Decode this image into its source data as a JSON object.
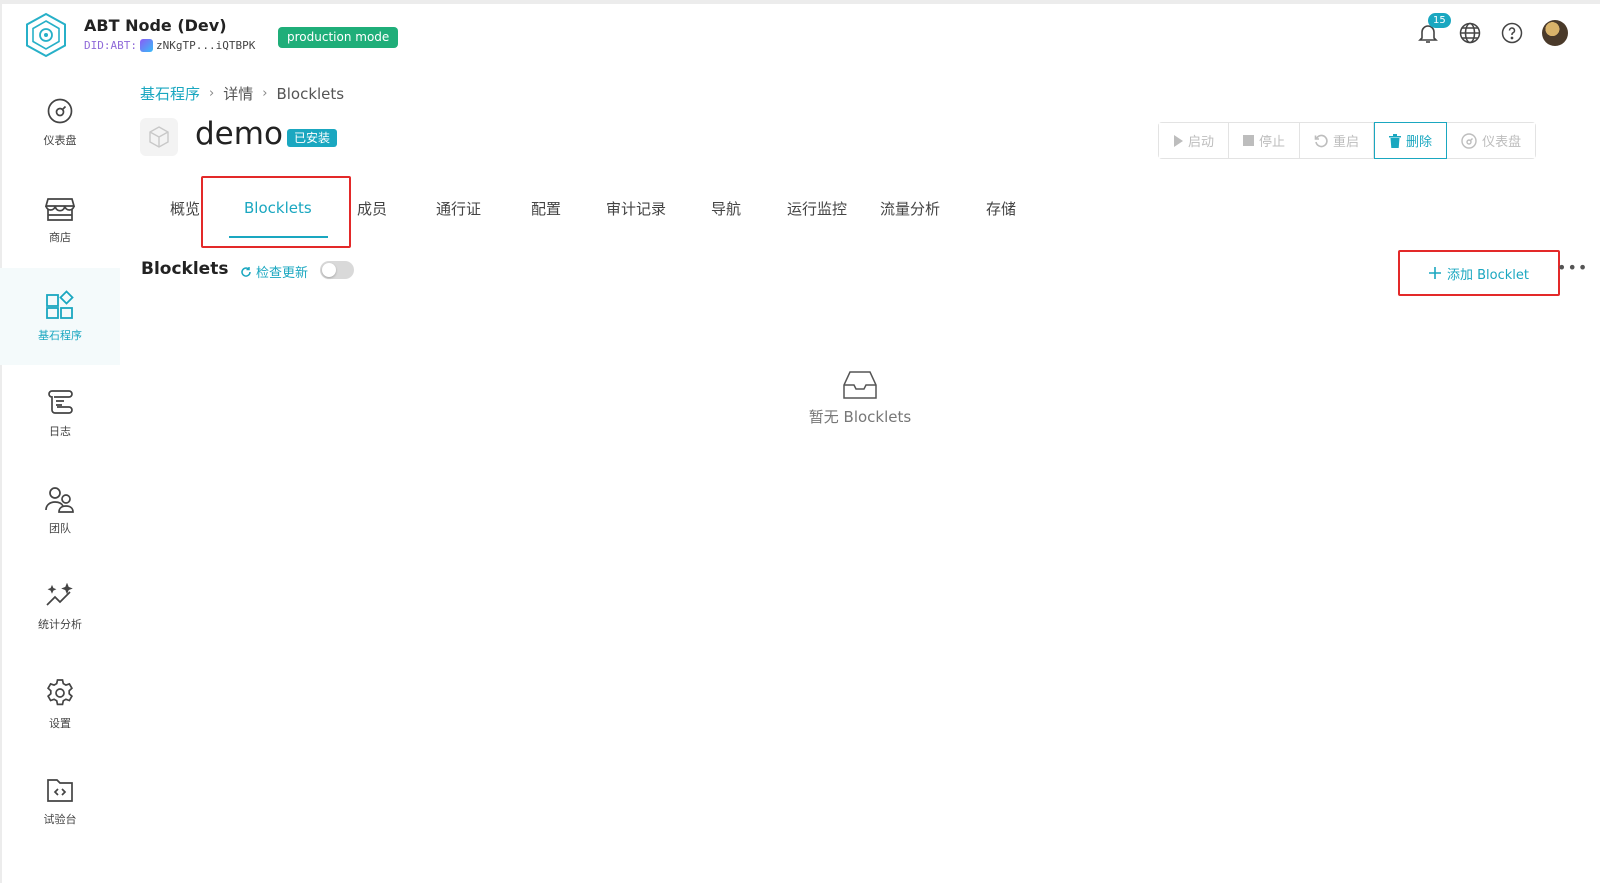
{
  "header": {
    "app_title": "ABT Node (Dev)",
    "did_label": "DID:ABT:",
    "did_value": "zNKgTP...iQTBPK",
    "mode_badge": "production mode",
    "notification_count": "15"
  },
  "sidebar": {
    "items": [
      {
        "label": "仪表盘",
        "icon": "dashboard-icon"
      },
      {
        "label": "商店",
        "icon": "store-icon"
      },
      {
        "label": "基石程序",
        "icon": "blocklet-icon",
        "active": true
      },
      {
        "label": "日志",
        "icon": "logs-icon"
      },
      {
        "label": "团队",
        "icon": "team-icon"
      },
      {
        "label": "统计分析",
        "icon": "analytics-icon"
      },
      {
        "label": "设置",
        "icon": "settings-icon"
      },
      {
        "label": "试验台",
        "icon": "playground-icon"
      }
    ]
  },
  "breadcrumb": {
    "root": "基石程序",
    "detail": "详情",
    "current": "Blocklets"
  },
  "app": {
    "name": "demo",
    "status": "已安装"
  },
  "actions": {
    "start": "启动",
    "stop": "停止",
    "restart": "重启",
    "delete": "删除",
    "dashboard": "仪表盘"
  },
  "tabs": [
    "概览",
    "Blocklets",
    "成员",
    "通行证",
    "配置",
    "审计记录",
    "导航",
    "运行监控",
    "流量分析",
    "存储"
  ],
  "blocklets_section": {
    "title": "Blocklets",
    "check_update": "检查更新",
    "add_button": "添加 Blocklet",
    "more": "•••",
    "empty_text": "暂无 Blocklets"
  },
  "colors": {
    "accent": "#1aa7c0",
    "production_badge": "#1fae79",
    "highlight": "#e32929"
  }
}
